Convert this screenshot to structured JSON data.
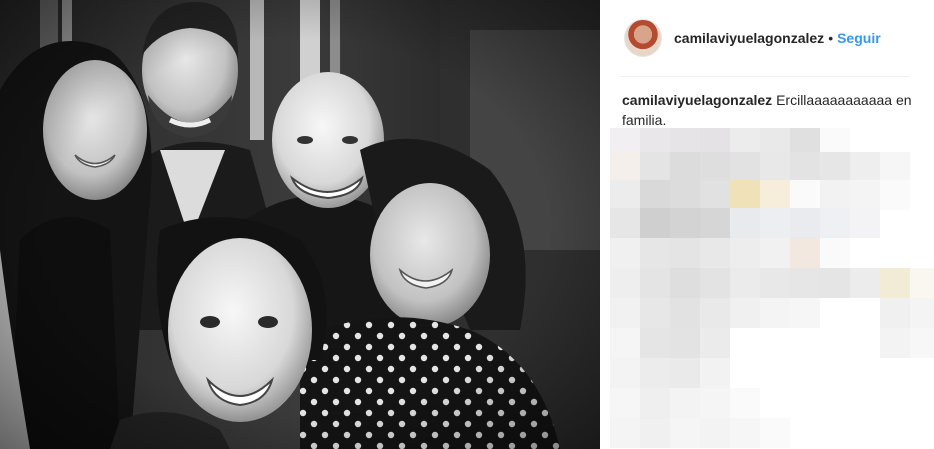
{
  "post": {
    "username": "camilaviyuelagonzalez",
    "separator": "•",
    "follow_label": "Seguir"
  },
  "caption": {
    "username": "camilaviyuelagonzalez",
    "text": "Ercillaaaaaaaaaaa en familia."
  },
  "photo": {
    "style": "black-and-white group selfie"
  },
  "icons": [
    "avatar"
  ],
  "colors": {
    "follow": "#3897f0",
    "text": "#262626",
    "divider": "#efefef"
  }
}
